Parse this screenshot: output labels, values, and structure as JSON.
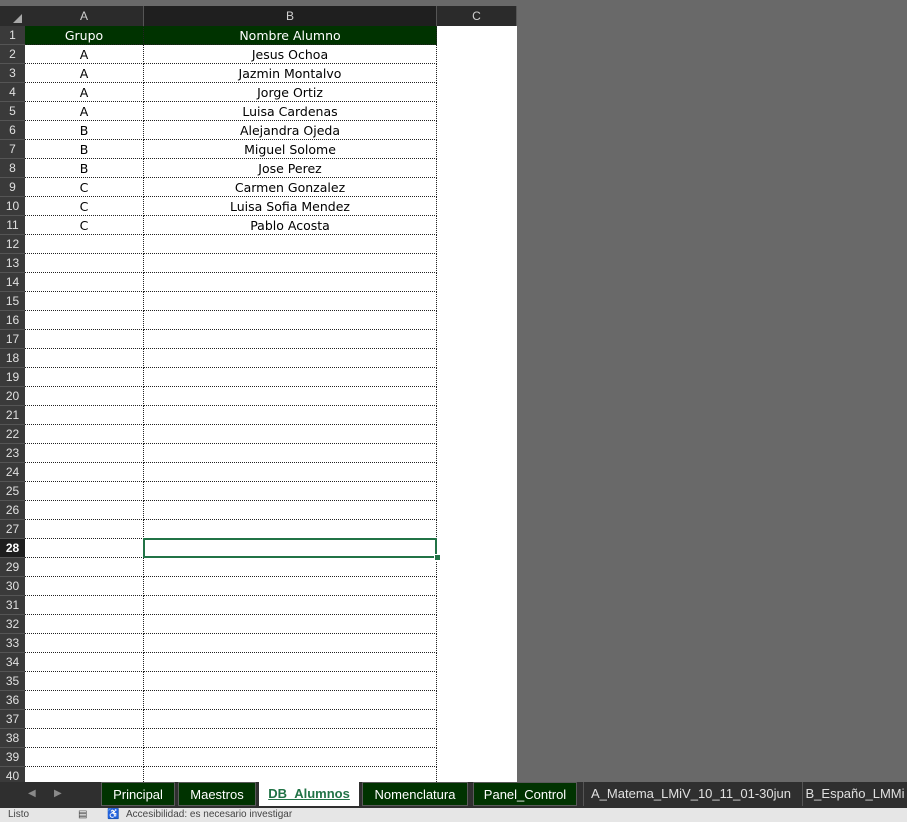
{
  "columns": [
    "A",
    "B",
    "C"
  ],
  "header_row": {
    "grupo": "Grupo",
    "nombre": "Nombre Alumno"
  },
  "rows": [
    {
      "grupo": "A",
      "nombre": "Jesus Ochoa"
    },
    {
      "grupo": "A",
      "nombre": "Jazmin Montalvo"
    },
    {
      "grupo": "A",
      "nombre": "Jorge Ortiz"
    },
    {
      "grupo": "A",
      "nombre": "Luisa Cardenas"
    },
    {
      "grupo": "B",
      "nombre": "Alejandra Ojeda"
    },
    {
      "grupo": "B",
      "nombre": "Miguel Solome"
    },
    {
      "grupo": "B",
      "nombre": "Jose Perez"
    },
    {
      "grupo": "C",
      "nombre": "Carmen Gonzalez"
    },
    {
      "grupo": "C",
      "nombre": "Luisa Sofia Mendez"
    },
    {
      "grupo": "C",
      "nombre": "Pablo Acosta"
    }
  ],
  "row_numbers": [
    "1",
    "2",
    "3",
    "4",
    "5",
    "6",
    "7",
    "8",
    "9",
    "10",
    "11",
    "12",
    "13",
    "14",
    "15",
    "16",
    "17",
    "18",
    "19",
    "20",
    "21",
    "22",
    "23",
    "24",
    "25",
    "26",
    "27",
    "28",
    "29",
    "30",
    "31",
    "32",
    "33",
    "34",
    "35",
    "36",
    "37",
    "38",
    "39",
    "40"
  ],
  "selected_row": "28",
  "selected_column": "B",
  "tabs": [
    {
      "label": "Principal",
      "style": "dark"
    },
    {
      "label": "Maestros",
      "style": "dark"
    },
    {
      "label": "DB_Alumnos",
      "style": "active"
    },
    {
      "label": "Nomenclatura",
      "style": "dark"
    },
    {
      "label": "Panel_Control",
      "style": "dark"
    },
    {
      "label": "A_Matema_LMiV_10_11_01-30jun",
      "style": "plain"
    },
    {
      "label": "B_Españo_LMMi",
      "style": "plain"
    }
  ],
  "nav_icons": [
    "scroll-left-icon",
    "scroll-right-icon"
  ],
  "status": {
    "ready": "Listo",
    "accessibility": "Accesibilidad: es necesario investigar"
  },
  "colors": {
    "header_fill": "#003300",
    "selection": "#217346",
    "canvas": "#696969"
  }
}
